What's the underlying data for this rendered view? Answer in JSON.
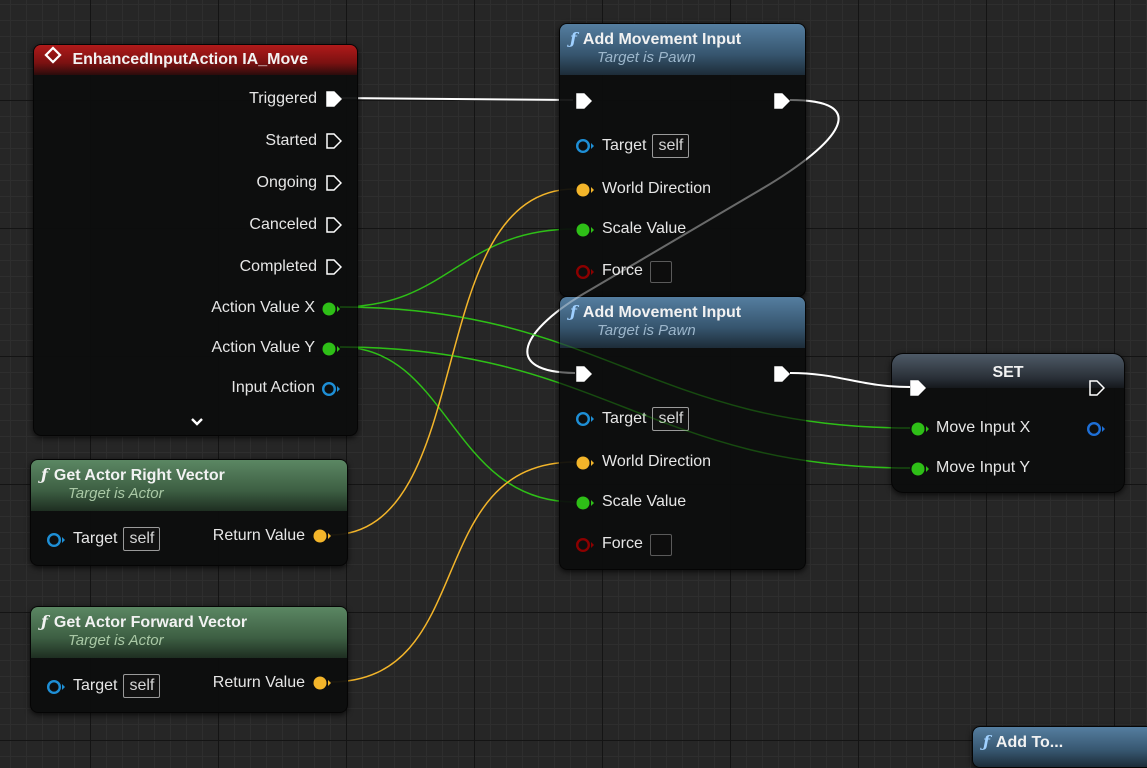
{
  "event_node": {
    "title": "EnhancedInputAction IA_Move",
    "pins": [
      "Triggered",
      "Started",
      "Ongoing",
      "Canceled",
      "Completed",
      "Action Value X",
      "Action Value Y",
      "Input Action"
    ],
    "expand_icon": "chevron-down-icon"
  },
  "add_movement_1": {
    "title": "Add Movement Input",
    "subtitle": "Target is Pawn",
    "target_label": "Target",
    "target_value": "self",
    "world_direction": "World Direction",
    "scale_value": "Scale Value",
    "force": "Force"
  },
  "add_movement_2": {
    "title": "Add Movement Input",
    "subtitle": "Target is Pawn",
    "target_label": "Target",
    "target_value": "self",
    "world_direction": "World Direction",
    "scale_value": "Scale Value",
    "force": "Force"
  },
  "get_right": {
    "title": "Get Actor Right Vector",
    "subtitle": "Target is Actor",
    "target_label": "Target",
    "target_value": "self",
    "return_label": "Return Value"
  },
  "get_forward": {
    "title": "Get Actor Forward Vector",
    "subtitle": "Target is Actor",
    "target_label": "Target",
    "target_value": "self",
    "return_label": "Return Value"
  },
  "set_node": {
    "title": "SET",
    "pin_x": "Move Input X",
    "pin_y": "Move Input Y"
  },
  "partial_node": {
    "title": "Add To..."
  },
  "colors": {
    "exec": "#ffffff",
    "float": "#2ebf17",
    "vector": "#f3b52a",
    "object": "#1e8fd6",
    "bool": "#8c0000",
    "event_header": "#a11717",
    "function_header": "#3f6a8c",
    "pure_header": "#4d7a53"
  },
  "icons": [
    "function-icon",
    "event-diamond-icon",
    "exec-pin-icon",
    "data-pin-icon",
    "object-pin-icon",
    "chevron-down-icon"
  ]
}
